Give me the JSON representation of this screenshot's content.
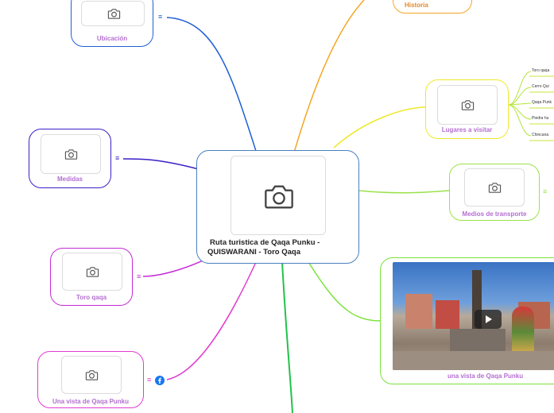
{
  "central": {
    "title_line1": "Ruta turistica de Qaqa Punku -",
    "title_line2": "QUISWARANI - Toro Qaqa",
    "icon": "camera-icon"
  },
  "nodes": {
    "historia": "Historia",
    "ubicacion": "Ubicación",
    "medidas": "Medidas",
    "toro_qaqa": "Toro qaqa",
    "vista_left": "Una vista de Qaqa Punku",
    "lugares": "Lugares a visitar",
    "medios": "Medios de transporte",
    "vista_right": "una vista de Qaqa Punku"
  },
  "lugares_items": [
    "Toro qaqa",
    "Cerro Qui",
    "Qaqa Punk",
    "Piedra  hu",
    "Chincana"
  ],
  "colors": {
    "historia": "#f5a623",
    "ubicacion": "#1f5fd6",
    "medidas": "#3a1fc7",
    "toro_qaqa": "#c52ad6",
    "vista_left": "#e23bd1",
    "lugares": "#f0e82a",
    "medios": "#9be24a",
    "vista_right": "#7be23a",
    "bottom": "#22c24a",
    "label": "#b46fd0",
    "central_border": "#4a7fc1"
  }
}
